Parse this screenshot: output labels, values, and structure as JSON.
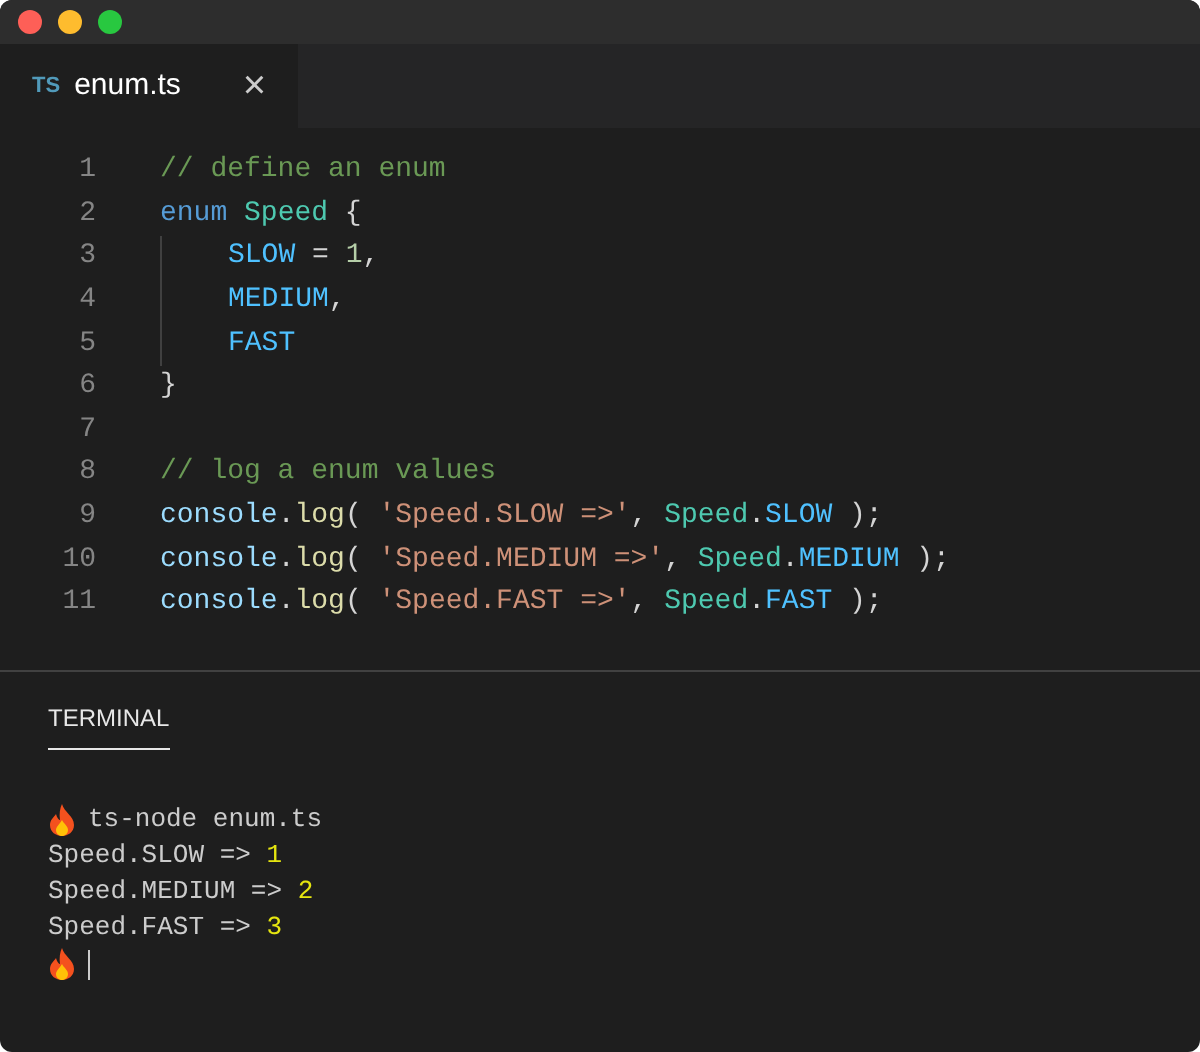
{
  "tab": {
    "badge": "TS",
    "title": "enum.ts",
    "close": "×",
    "selected": true
  },
  "code": [
    {
      "number": "1",
      "indented": false,
      "tokens": [
        {
          "text": "// define an enum",
          "kind": "comment"
        }
      ]
    },
    {
      "number": "2",
      "indented": false,
      "tokens": [
        {
          "text": "enum",
          "kind": "keyword"
        },
        {
          "text": " Speed",
          "kind": "type"
        },
        {
          "text": " {",
          "kind": "plain"
        }
      ]
    },
    {
      "number": "3",
      "indented": true,
      "tokens": [
        {
          "text": "SLOW",
          "kind": "member"
        },
        {
          "text": " = ",
          "kind": "plain"
        },
        {
          "text": "1",
          "kind": "number"
        },
        {
          "text": ",",
          "kind": "plain"
        }
      ]
    },
    {
      "number": "4",
      "indented": true,
      "tokens": [
        {
          "text": "MEDIUM",
          "kind": "member"
        },
        {
          "text": ",",
          "kind": "plain"
        }
      ]
    },
    {
      "number": "5",
      "indented": true,
      "tokens": [
        {
          "text": "FAST",
          "kind": "member"
        }
      ]
    },
    {
      "number": "6",
      "indented": false,
      "tokens": [
        {
          "text": "}",
          "kind": "plain"
        }
      ]
    },
    {
      "number": "7",
      "indented": false
    },
    {
      "number": "8",
      "indented": false,
      "tokens": [
        {
          "text": "// log a enum values",
          "kind": "comment"
        }
      ]
    },
    {
      "number": "9",
      "indented": false,
      "tokens": [
        {
          "text": "console",
          "kind": "variable"
        },
        {
          "text": ".",
          "kind": "plain"
        },
        {
          "text": "log",
          "kind": "function"
        },
        {
          "text": "( ",
          "kind": "plain"
        },
        {
          "text": "'Speed.SLOW =>'",
          "kind": "string"
        },
        {
          "text": ", ",
          "kind": "plain"
        },
        {
          "text": "Speed",
          "kind": "type"
        },
        {
          "text": ".",
          "kind": "plain"
        },
        {
          "text": "SLOW",
          "kind": "member"
        },
        {
          "text": " );",
          "kind": "plain"
        }
      ]
    },
    {
      "number": "10",
      "indented": false,
      "tokens": [
        {
          "text": "console",
          "kind": "variable"
        },
        {
          "text": ".",
          "kind": "plain"
        },
        {
          "text": "log",
          "kind": "function"
        },
        {
          "text": "( ",
          "kind": "plain"
        },
        {
          "text": "'Speed.MEDIUM =>'",
          "kind": "string"
        },
        {
          "text": ", ",
          "kind": "plain"
        },
        {
          "text": "Speed",
          "kind": "type"
        },
        {
          "text": ".",
          "kind": "plain"
        },
        {
          "text": "MEDIUM",
          "kind": "member"
        },
        {
          "text": " );",
          "kind": "plain"
        }
      ]
    },
    {
      "number": "11",
      "indented": false,
      "tokens": [
        {
          "text": "console",
          "kind": "variable"
        },
        {
          "text": ".",
          "kind": "plain"
        },
        {
          "text": "log",
          "kind": "function"
        },
        {
          "text": "( ",
          "kind": "plain"
        },
        {
          "text": "'Speed.FAST =>'",
          "kind": "string"
        },
        {
          "text": ", ",
          "kind": "plain"
        },
        {
          "text": "Speed",
          "kind": "type"
        },
        {
          "text": ".",
          "kind": "plain"
        },
        {
          "text": "FAST",
          "kind": "member"
        },
        {
          "text": " );",
          "kind": "plain"
        }
      ]
    }
  ],
  "terminal": {
    "tab": {
      "label": "TERMINAL",
      "selected": true
    },
    "lines": [
      {
        "kind": "command",
        "text": "ts-node enum.ts"
      },
      {
        "kind": "output",
        "text": "Speed.SLOW =>",
        "value": "1"
      },
      {
        "kind": "output",
        "text": "Speed.MEDIUM =>",
        "value": "2"
      },
      {
        "kind": "output",
        "text": "Speed.FAST =>",
        "value": "3"
      },
      {
        "kind": "prompt"
      }
    ]
  }
}
